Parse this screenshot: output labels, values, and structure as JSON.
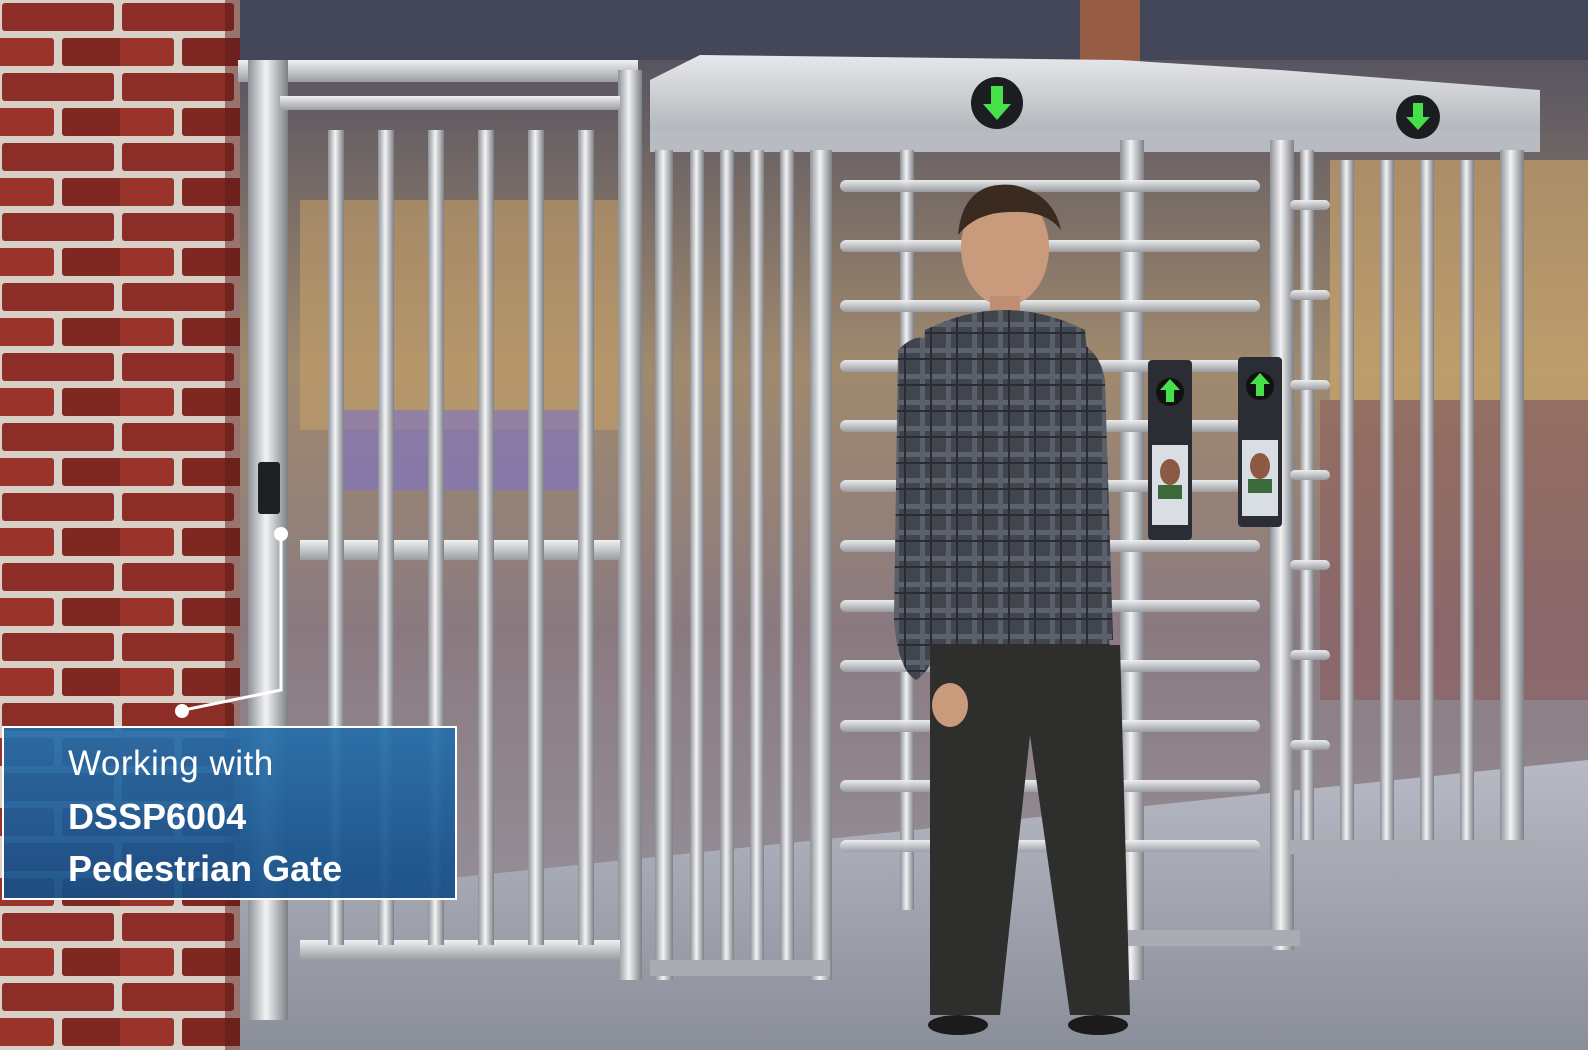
{
  "caption": {
    "line1": "Working with",
    "line2": "DSSP6004",
    "line3": "Pedestrian Gate"
  },
  "colors": {
    "caption_background": "#1f6aa8",
    "caption_text": "#ffffff",
    "arrow_signal": "#45e04a",
    "brick": "#8a2a24",
    "steel": "#c9ccd1"
  },
  "icons": {
    "turnstile_signal_1": "arrow-down-icon",
    "turnstile_signal_2": "arrow-down-icon",
    "terminal_signal_1": "arrow-up-icon",
    "terminal_signal_2": "arrow-up-icon"
  }
}
